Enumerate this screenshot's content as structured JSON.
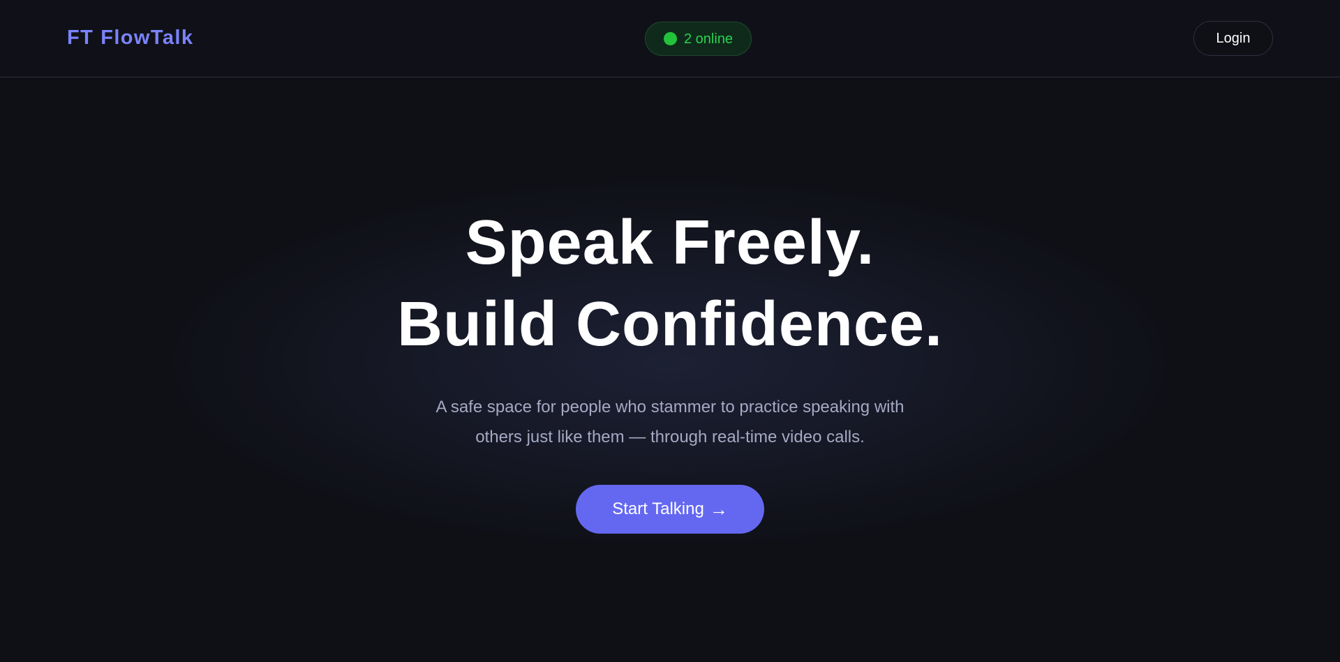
{
  "header": {
    "brand_mark": "FT",
    "brand_name": "FlowTalk",
    "online_status": "2 online",
    "login_label": "Login"
  },
  "hero": {
    "headline_line1": "Speak Freely.",
    "headline_line2": "Build Confidence.",
    "subtitle_line1": "A safe space for people who stammer to practice speaking with",
    "subtitle_line2": "others just like them — through real-time video calls.",
    "cta_label": "Start Talking",
    "cta_arrow": "→"
  },
  "colors": {
    "background": "#0f1016",
    "brand": "#7b83ff",
    "online_green": "#22c33a",
    "cta": "#6468f0",
    "subtitle": "#a6a9c3"
  }
}
